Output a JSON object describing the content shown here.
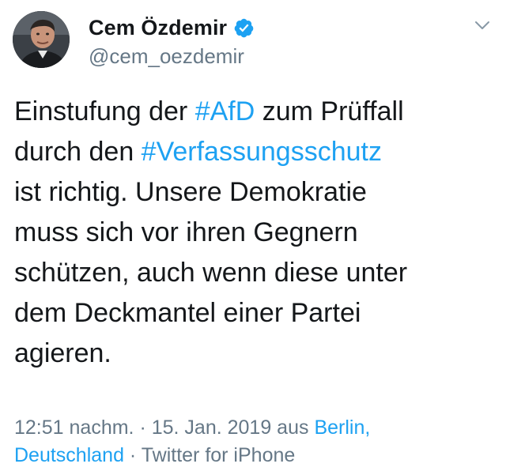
{
  "author": {
    "display_name": "Cem Özdemir",
    "handle": "@cem_oezdemir",
    "verified": true,
    "avatar_icon": "profile-photo"
  },
  "tweet": {
    "line1_text": "Einstufung der ",
    "line1_hashtag": "#AfD",
    "line1_rest": " zum Prüffall",
    "line2_text": "durch den ",
    "line2_hashtag": "#Verfassungsschutz",
    "line3": "ist richtig. Unsere Demokratie",
    "line4": "muss sich vor ihren Gegnern",
    "line5": "schützen, auch wenn diese unter",
    "line6": "dem Deckmantel einer Partei",
    "line7": "agieren."
  },
  "meta": {
    "time": "12:51 nachm.",
    "sep1": " · ",
    "date": "15. Jan. 2019",
    "from": " aus ",
    "location_part1": "Berlin,",
    "location_part2": "Deutschland",
    "sep2": " · ",
    "source": "Twitter for iPhone"
  },
  "colors": {
    "link": "#1da1f2",
    "secondary_text": "#657786",
    "primary_text": "#14171a",
    "verified_badge": "#1da1f2"
  },
  "icons": {
    "menu": "chevron-down-icon",
    "badge": "verified-icon"
  }
}
